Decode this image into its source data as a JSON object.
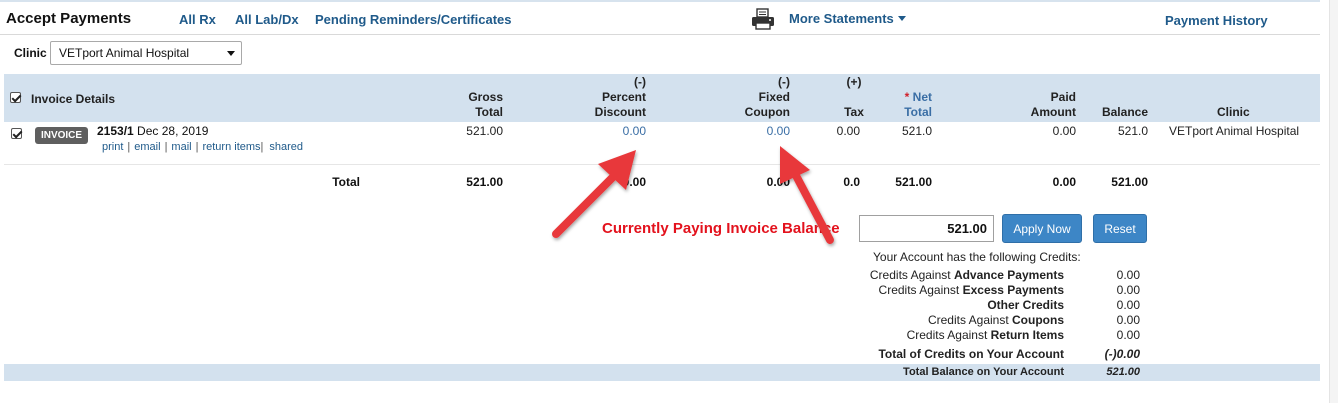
{
  "header": {
    "title": "Accept Payments",
    "nav": [
      "All Rx",
      "All Lab/Dx",
      "Pending Reminders/Certificates"
    ],
    "more_statements": "More Statements",
    "payment_history": "Payment History"
  },
  "clinic_filter": {
    "label": "Clinic",
    "selected": "VETport Animal Hospital"
  },
  "table": {
    "headers": {
      "invoice_details": "Invoice Details",
      "gross": [
        "Gross",
        "Total"
      ],
      "percent_discount": [
        "(-)",
        "Percent",
        "Discount"
      ],
      "fixed_coupon": [
        "(-)",
        "Fixed",
        "Coupon"
      ],
      "tax": [
        "(+)",
        "Tax"
      ],
      "net": [
        "*",
        "Net",
        "Total"
      ],
      "paid": [
        "Paid",
        "Amount"
      ],
      "balance": "Balance",
      "clinic": "Clinic"
    },
    "row": {
      "badge": "INVOICE",
      "invoice_no": "2153/1",
      "date": "Dec 28, 2019",
      "actions": [
        "print",
        "email",
        "mail",
        "return items",
        "shared"
      ],
      "gross_total": "521.00",
      "percent_discount": "0.00",
      "fixed_coupon": "0.00",
      "tax": "0.00",
      "net_total": "521.0",
      "paid_amount": "0.00",
      "balance": "521.0",
      "clinic": "VETport Animal Hospital"
    },
    "totals": {
      "label": "Total",
      "gross_total": "521.00",
      "percent_discount": "0.00",
      "fixed_coupon": "0.00",
      "tax": "0.0",
      "net_total": "521.00",
      "paid_amount": "0.00",
      "balance": "521.00"
    }
  },
  "payment": {
    "annotation": "Currently Paying Invoice Balance",
    "amount": "521.00",
    "apply_label": "Apply Now",
    "reset_label": "Reset"
  },
  "credits": {
    "heading": "Your Account has the following Credits:",
    "items": [
      {
        "prefix": "Credits Against ",
        "emph": "Advance Payments",
        "value": "0.00"
      },
      {
        "prefix": "Credits Against ",
        "emph": "Excess Payments",
        "value": "0.00"
      },
      {
        "prefix": "",
        "emph": "Other Credits",
        "value": "0.00"
      },
      {
        "prefix": "Credits Against ",
        "emph": "Coupons",
        "value": "0.00"
      },
      {
        "prefix": "Credits Against ",
        "emph": "Return Items",
        "value": "0.00"
      }
    ],
    "total_label": "Total of Credits on Your Account",
    "total_value": "(-)0.00",
    "balance_label": "Total Balance on Your Account",
    "balance_value": "521.00"
  },
  "colors": {
    "accent": "#3d86c6",
    "link": "#1f5a8a",
    "header_band": "#d3e1ee",
    "annotation": "#e3121d"
  }
}
